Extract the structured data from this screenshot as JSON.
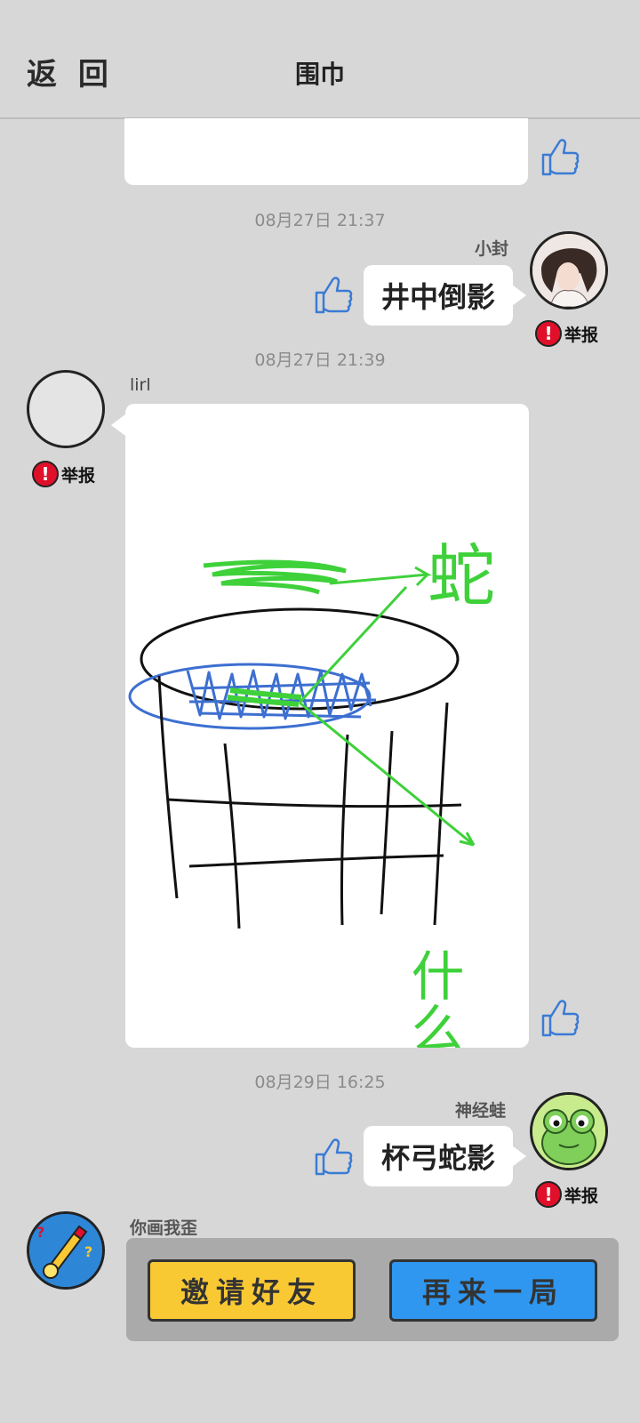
{
  "header": {
    "back_label": "返 回",
    "title": "围巾"
  },
  "messages": [
    {
      "timestamp": "08月27日  21:37",
      "user": "小封",
      "text": "井中倒影",
      "report": "举报"
    },
    {
      "timestamp": "08月27日  21:39",
      "user": "lirl",
      "report": "举报",
      "drawing_text": {
        "label_snake": "蛇",
        "label_what": "什么"
      }
    },
    {
      "timestamp": "08月29日  16:25",
      "user": "神经蛙",
      "text": "杯弓蛇影",
      "report": "举报"
    },
    {
      "user": "你画我歪",
      "invite_label": "邀请好友",
      "again_label": "再来一局"
    }
  ],
  "colors": {
    "background": "#d7d7d7",
    "report_red": "#e0102a",
    "like_blue": "#3a7bd5",
    "invite_yellow": "#f9c934",
    "again_blue": "#2f97f0",
    "sketch_green": "#3ed13a",
    "sketch_blue": "#3c6fd0"
  },
  "icons": [
    "thumbs-up-icon",
    "report-exclamation-icon"
  ]
}
